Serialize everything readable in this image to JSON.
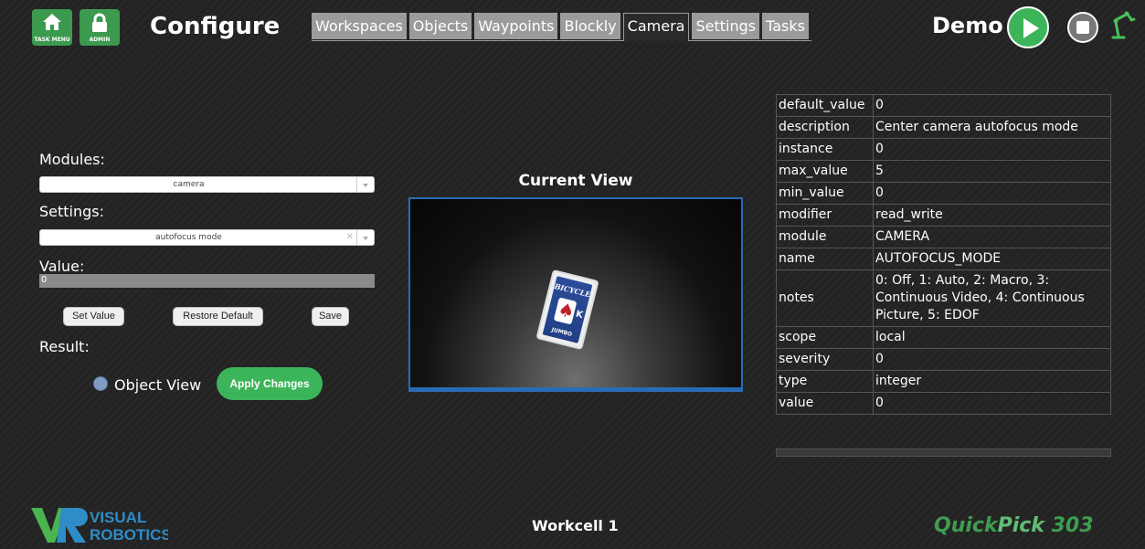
{
  "header": {
    "task_menu_label": "TASK MENU",
    "admin_label": "ADMIN",
    "title": "Configure",
    "tabs": [
      {
        "label": "Workspaces",
        "active": false
      },
      {
        "label": "Objects",
        "active": false
      },
      {
        "label": "Waypoints",
        "active": false
      },
      {
        "label": "Blockly",
        "active": false
      },
      {
        "label": "Camera",
        "active": true
      },
      {
        "label": "Settings",
        "active": false
      },
      {
        "label": "Tasks",
        "active": false
      }
    ],
    "mode_label": "Demo",
    "icons": {
      "play": "play-icon",
      "stop": "stop-icon",
      "robot": "robot-arm-icon"
    }
  },
  "left_panel": {
    "modules_label": "Modules:",
    "modules_value": "camera",
    "settings_label": "Settings:",
    "settings_value": "autofocus mode",
    "value_label": "Value:",
    "value": "0",
    "set_value_button": "Set Value",
    "restore_default_button": "Restore Default",
    "save_button": "Save",
    "result_label": "Result:",
    "object_view_label": "Object View",
    "apply_changes_button": "Apply Changes"
  },
  "camera_view": {
    "title": "Current View",
    "card_brand": "BICYCLE",
    "card_rank": "K",
    "card_jumbo": "JUMBO"
  },
  "properties": [
    {
      "key": "default_value",
      "value": "0"
    },
    {
      "key": "description",
      "value": "Center camera autofocus mode"
    },
    {
      "key": "instance",
      "value": "0"
    },
    {
      "key": "max_value",
      "value": "5"
    },
    {
      "key": "min_value",
      "value": "0"
    },
    {
      "key": "modifier",
      "value": "read_write"
    },
    {
      "key": "module",
      "value": "CAMERA"
    },
    {
      "key": "name",
      "value": "AUTOFOCUS_MODE"
    },
    {
      "key": "notes",
      "value": "0: Off, 1: Auto, 2: Macro, 3: Continuous Video, 4: Continuous Picture, 5: EDOF"
    },
    {
      "key": "scope",
      "value": "local"
    },
    {
      "key": "severity",
      "value": "0"
    },
    {
      "key": "type",
      "value": "integer"
    },
    {
      "key": "value",
      "value": "0"
    }
  ],
  "footer": {
    "logo_text_1": "VISUAL",
    "logo_text_2": "ROBOTICS",
    "workcell": "Workcell 1",
    "product_part1": "QuickPick",
    "product_part2": " 303"
  },
  "colors": {
    "accent_green": "#3cb55a",
    "tab_gray": "#9b9b9b",
    "camera_border": "#2c6ab5",
    "product_green": "#3e9d4f",
    "product_pick_green": "#5fbf76"
  }
}
